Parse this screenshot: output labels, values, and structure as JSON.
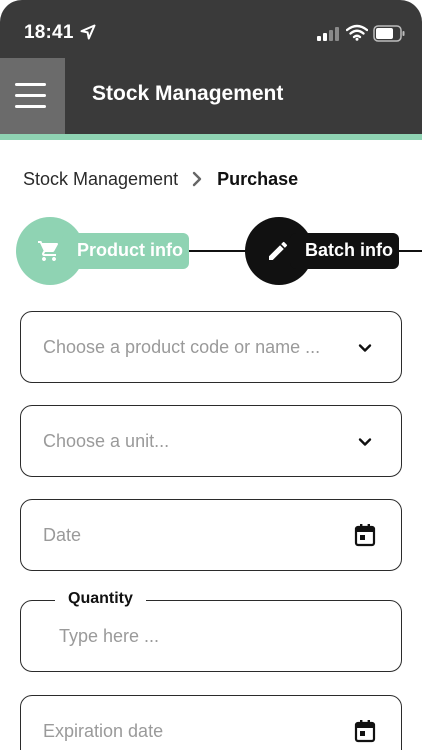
{
  "status_bar": {
    "time": "18:41",
    "icons": [
      "location-arrow-icon",
      "cellular-signal-icon",
      "wifi-icon",
      "battery-icon"
    ]
  },
  "app_bar": {
    "title": "Stock Management",
    "menu_icon": "hamburger-menu-icon",
    "background_color": "#3a3a3a",
    "accent_color": "#8fd3b3"
  },
  "breadcrumb": {
    "items": [
      "Stock Management"
    ],
    "current": "Purchase"
  },
  "stepper": {
    "steps": [
      {
        "label": "Product info",
        "icon": "cart-icon",
        "color": "#8fd3b3",
        "active": true
      },
      {
        "label": "Batch info",
        "icon": "pencil-icon",
        "color": "#111111",
        "active": false
      }
    ]
  },
  "form": {
    "product": {
      "placeholder": "Choose a product code or name ...",
      "icon": "chevron-down-icon"
    },
    "unit": {
      "placeholder": "Choose a unit...",
      "icon": "chevron-down-icon"
    },
    "date": {
      "placeholder": "Date",
      "icon": "calendar-icon"
    },
    "quantity": {
      "label": "Quantity",
      "placeholder": "Type here ...",
      "value": ""
    },
    "expiration": {
      "placeholder": "Expiration date",
      "icon": "calendar-icon"
    }
  }
}
